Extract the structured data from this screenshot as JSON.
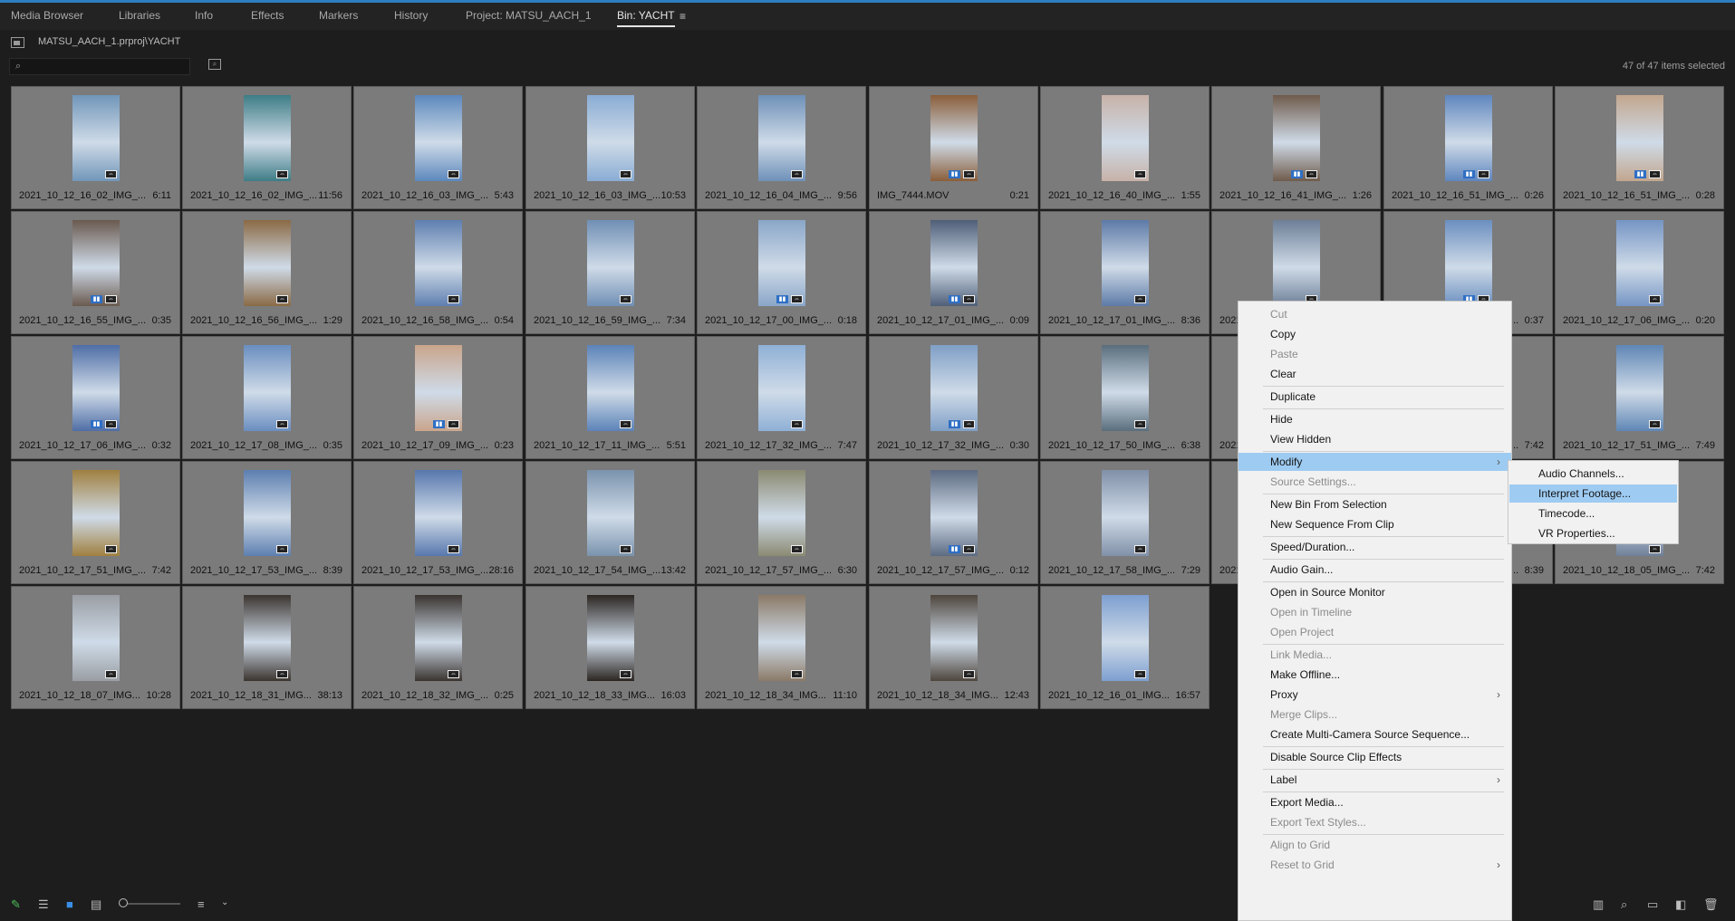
{
  "tabs": [
    "Media Browser",
    "Libraries",
    "Info",
    "Effects",
    "Markers",
    "History",
    "Project: MATSU_AACH_1",
    "Bin: YACHT"
  ],
  "active_tab_menu": "≡",
  "path": "MATSU_AACH_1.prproj\\YACHT",
  "search": {
    "placeholder": ""
  },
  "items_selected": "47 of 47 items selected",
  "clips": [
    {
      "name": "2021_10_12_16_02_IMG_...",
      "dur": "6:11",
      "color": "#7196b9",
      "badge": "single"
    },
    {
      "name": "2021_10_12_16_02_IMG_...",
      "dur": "11:56",
      "color": "#3e7d86",
      "badge": "single"
    },
    {
      "name": "2021_10_12_16_03_IMG_...",
      "dur": "5:43",
      "color": "#5c88bd",
      "badge": "single"
    },
    {
      "name": "2021_10_12_16_03_IMG_...",
      "dur": "10:53",
      "color": "#89acd4",
      "badge": "single"
    },
    {
      "name": "2021_10_12_16_04_IMG_...",
      "dur": "9:56",
      "color": "#6e90b8",
      "badge": "single"
    },
    {
      "name": "IMG_7444.MOV",
      "dur": "0:21",
      "color": "#8a5e3a",
      "badge": "double"
    },
    {
      "name": "2021_10_12_16_40_IMG_...",
      "dur": "1:55",
      "color": "#c7b2a8",
      "badge": "single"
    },
    {
      "name": "2021_10_12_16_41_IMG_...",
      "dur": "1:26",
      "color": "#6f5b4c",
      "badge": "double"
    },
    {
      "name": "2021_10_12_16_51_IMG_...",
      "dur": "0:26",
      "color": "#5f86be",
      "badge": "double"
    },
    {
      "name": "2021_10_12_16_51_IMG_...",
      "dur": "0:28",
      "color": "#c2a68e",
      "badge": "double"
    },
    {
      "name": "2021_10_12_16_55_IMG_...",
      "dur": "0:35",
      "color": "#6a5a50",
      "badge": "double"
    },
    {
      "name": "2021_10_12_16_56_IMG_...",
      "dur": "1:29",
      "color": "#8a6a45",
      "badge": "single"
    },
    {
      "name": "2021_10_12_16_58_IMG_...",
      "dur": "0:54",
      "color": "#5f7fb0",
      "badge": "single"
    },
    {
      "name": "2021_10_12_16_59_IMG_...",
      "dur": "7:34",
      "color": "#708fb5",
      "badge": "single"
    },
    {
      "name": "2021_10_12_17_00_IMG_...",
      "dur": "0:18",
      "color": "#8aa6c8",
      "badge": "double"
    },
    {
      "name": "2021_10_12_17_01_IMG_...",
      "dur": "0:09",
      "color": "#4f5f78",
      "badge": "double"
    },
    {
      "name": "2021_10_12_17_01_IMG_...",
      "dur": "8:36",
      "color": "#5d7aa7",
      "badge": "single"
    },
    {
      "name": "2021_10_12_17_03_IMG_...",
      "dur": "",
      "color": "#6d7f97",
      "badge": "single"
    },
    {
      "name": "2021_10_12_17_04_IMG_...",
      "dur": "0:37",
      "color": "#6b8fc0",
      "badge": "double"
    },
    {
      "name": "2021_10_12_17_06_IMG_...",
      "dur": "0:20",
      "color": "#7595c4",
      "badge": "single"
    },
    {
      "name": "2021_10_12_17_06_IMG_...",
      "dur": "0:32",
      "color": "#4f6ea6",
      "badge": "double"
    },
    {
      "name": "2021_10_12_17_08_IMG_...",
      "dur": "0:35",
      "color": "#6a8ec0",
      "badge": "single"
    },
    {
      "name": "2021_10_12_17_09_IMG_...",
      "dur": "0:23",
      "color": "#c9a58c",
      "badge": "double"
    },
    {
      "name": "2021_10_12_17_11_IMG_...",
      "dur": "5:51",
      "color": "#5c83b8",
      "badge": "single"
    },
    {
      "name": "2021_10_12_17_32_IMG_...",
      "dur": "7:47",
      "color": "#8fb0d6",
      "badge": "single"
    },
    {
      "name": "2021_10_12_17_32_IMG_...",
      "dur": "0:30",
      "color": "#7f9fc6",
      "badge": "double"
    },
    {
      "name": "2021_10_12_17_50_IMG_...",
      "dur": "6:38",
      "color": "#5a6e7d",
      "badge": "single"
    },
    {
      "name": "2021_10_12_17_50_IMG_...",
      "dur": "",
      "color": "#7a8da3",
      "badge": "single"
    },
    {
      "name": "2021_10_12_17_51_IMG_...",
      "dur": "7:42",
      "color": "#6e8fb8",
      "badge": "single"
    },
    {
      "name": "2021_10_12_17_51_IMG_...",
      "dur": "7:49",
      "color": "#5f86b5",
      "badge": "single"
    },
    {
      "name": "2021_10_12_17_51_IMG_...",
      "dur": "7:42",
      "color": "#a08040",
      "badge": "single"
    },
    {
      "name": "2021_10_12_17_53_IMG_...",
      "dur": "8:39",
      "color": "#5d7fb0",
      "badge": "single"
    },
    {
      "name": "2021_10_12_17_53_IMG_...",
      "dur": "28:16",
      "color": "#5777ad",
      "badge": "single"
    },
    {
      "name": "2021_10_12_17_54_IMG_...",
      "dur": "13:42",
      "color": "#7a93ad",
      "badge": "single"
    },
    {
      "name": "2021_10_12_17_57_IMG_...",
      "dur": "6:30",
      "color": "#8b8a72",
      "badge": "single"
    },
    {
      "name": "2021_10_12_17_57_IMG_...",
      "dur": "0:12",
      "color": "#5d6b82",
      "badge": "double"
    },
    {
      "name": "2021_10_12_17_58_IMG_...",
      "dur": "7:29",
      "color": "#8090a8",
      "badge": "single"
    },
    {
      "name": "2021_10_12_17_59_IMG_...",
      "dur": "",
      "color": "#7a8ba0",
      "badge": "single"
    },
    {
      "name": "2021_10_12_18_01_IMG_...",
      "dur": "8:39",
      "color": "#7d8ea5",
      "badge": "single"
    },
    {
      "name": "2021_10_12_18_05_IMG_...",
      "dur": "7:42",
      "color": "#6f8099",
      "badge": "single"
    },
    {
      "name": "2021_10_12_18_07_IMG...",
      "dur": "10:28",
      "color": "#9a9ea4",
      "badge": "single"
    },
    {
      "name": "2021_10_12_18_31_IMG...",
      "dur": "38:13",
      "color": "#3c3530",
      "badge": "single"
    },
    {
      "name": "2021_10_12_18_32_IMG_...",
      "dur": "0:25",
      "color": "#3a3430",
      "badge": "single"
    },
    {
      "name": "2021_10_12_18_33_IMG...",
      "dur": "16:03",
      "color": "#2c2622",
      "badge": "single"
    },
    {
      "name": "2021_10_12_18_34_IMG...",
      "dur": "11:10",
      "color": "#8b7a67",
      "badge": "single"
    },
    {
      "name": "2021_10_12_18_34_IMG...",
      "dur": "12:43",
      "color": "#4e463d",
      "badge": "single"
    },
    {
      "name": "2021_10_12_16_01_IMG...",
      "dur": "16:57",
      "color": "#7d9fd0",
      "badge": "single"
    }
  ],
  "context_menu": [
    {
      "label": "Cut",
      "disabled": true
    },
    {
      "label": "Copy",
      "disabled": false
    },
    {
      "label": "Paste",
      "disabled": true
    },
    {
      "label": "Clear",
      "disabled": false
    },
    {
      "sep": true
    },
    {
      "label": "Duplicate",
      "disabled": false
    },
    {
      "sep": true
    },
    {
      "label": "Hide",
      "disabled": false
    },
    {
      "label": "View Hidden",
      "disabled": false
    },
    {
      "sep": true
    },
    {
      "label": "Modify",
      "disabled": false,
      "highlight": true,
      "submenu": true
    },
    {
      "label": "Source Settings...",
      "disabled": true
    },
    {
      "sep": true
    },
    {
      "label": "New Bin From Selection",
      "disabled": false
    },
    {
      "label": "New Sequence From Clip",
      "disabled": false
    },
    {
      "sep": true
    },
    {
      "label": "Speed/Duration...",
      "disabled": false
    },
    {
      "sep": true
    },
    {
      "label": "Audio Gain...",
      "disabled": false
    },
    {
      "sep": true
    },
    {
      "label": "Open in Source Monitor",
      "disabled": false
    },
    {
      "label": "Open in Timeline",
      "disabled": true
    },
    {
      "label": "Open Project",
      "disabled": true
    },
    {
      "sep": true
    },
    {
      "label": "Link Media...",
      "disabled": true
    },
    {
      "label": "Make Offline...",
      "disabled": false
    },
    {
      "label": "Proxy",
      "disabled": false,
      "submenu": true
    },
    {
      "label": "Merge Clips...",
      "disabled": true
    },
    {
      "label": "Create Multi-Camera Source Sequence...",
      "disabled": false
    },
    {
      "sep": true
    },
    {
      "label": "Disable Source Clip Effects",
      "disabled": false
    },
    {
      "sep": true
    },
    {
      "label": "Label",
      "disabled": false,
      "submenu": true
    },
    {
      "sep": true
    },
    {
      "label": "Export Media...",
      "disabled": false
    },
    {
      "label": "Export Text Styles...",
      "disabled": true
    },
    {
      "sep": true
    },
    {
      "label": "Align to Grid",
      "disabled": true
    },
    {
      "label": "Reset to Grid",
      "disabled": true,
      "submenu": true
    }
  ],
  "submenu_modify": [
    {
      "label": "Audio Channels...",
      "highlight": false
    },
    {
      "label": "Interpret Footage...",
      "highlight": true
    },
    {
      "label": "Timecode...",
      "highlight": false
    },
    {
      "label": "VR Properties...",
      "highlight": false
    }
  ]
}
